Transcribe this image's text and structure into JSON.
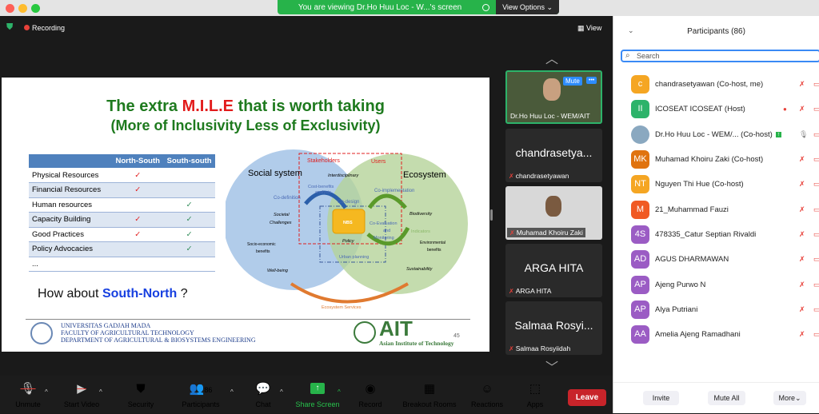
{
  "window": {
    "banner": "You are viewing Dr.Ho Huu Loc - W...'s screen",
    "view_options": "View Options",
    "recording": "Recording",
    "view": "View"
  },
  "slide": {
    "title_pre": "The extra ",
    "title_mile": "M.I.L.E",
    "title_post": " that is worth taking",
    "subtitle": "(More of Inclusivity Less of Exclusivity)",
    "table": {
      "headers": [
        "",
        "North-South",
        "South-south"
      ],
      "rows": [
        [
          "Physical Resources",
          true,
          false
        ],
        [
          "Financial Resources",
          true,
          false
        ],
        [
          "Human resources",
          false,
          true
        ],
        [
          "Capacity Building",
          true,
          true
        ],
        [
          "Good Practices",
          true,
          true
        ],
        [
          "Policy Advocacies",
          false,
          true
        ],
        [
          "...",
          false,
          false
        ]
      ]
    },
    "check": "✓",
    "question_pre": "How about ",
    "question_em": "South-North",
    "question_post": " ?",
    "diagram": {
      "social": "Social system",
      "eco": "Ecosystem",
      "stakeholders": "Stakeholders",
      "users": "Users",
      "interdisciplinary": "Interdisciplinary",
      "cost1": "Cost-benefits",
      "cost2": "analysis",
      "codef": "Co-definition",
      "codesign": "Co-design",
      "coimpl": "Co-implementation",
      "nbs": "NBS",
      "policy": "Policy",
      "coev1": "Co-Evaluation",
      "coev2": "and",
      "coev3": "Monitoring",
      "indicators": "Indicators",
      "soc1": "Societal",
      "soc2": "Challenges",
      "bio": "Biodiversity",
      "se1": "Socio-economic",
      "se2": "benefits",
      "env1": "Environmental",
      "env2": "benefits",
      "urban": "Urban planning",
      "wb": "Well-being",
      "sus": "Sustainability",
      "es": "Ecosystem Services"
    },
    "footer": {
      "ugm": [
        "UNIVERSITAS GADJAH MADA",
        "FACULTY OF AGRICULTURAL TECHNOLOGY",
        "DEPARTMENT OF AGRICULTURAL & BIOSYSTEMS ENGINEERING"
      ],
      "ait": "AIT",
      "ait_sub": "Asian Institute of Technology",
      "page": "45"
    }
  },
  "thumbnails": [
    {
      "name": "Dr.Ho Huu Loc - WEM/AIT",
      "mute": "Mute",
      "more": "•••",
      "video": true
    },
    {
      "name": "chandrasetyawan",
      "big": "chandrasetya..."
    },
    {
      "name": "Muhamad Khoiru Zaki",
      "video": true
    },
    {
      "name": "ARGA HITA",
      "big": "ARGA HITA"
    },
    {
      "name": "Salmaa Rosyiidah",
      "big": "Salmaa Rosyi..."
    }
  ],
  "toolbar": {
    "items": [
      "Unmute",
      "Start Video",
      "Security",
      "Participants",
      "Chat",
      "Share Screen",
      "Record",
      "Breakout Rooms",
      "Reactions",
      "Apps"
    ],
    "participant_count": "86",
    "leave": "Leave"
  },
  "participants": {
    "title": "Participants (86)",
    "search_placeholder": "Search",
    "list": [
      {
        "initials": "c",
        "name": "chandrasetyawan (Co-host, me)",
        "color": "#f5a623"
      },
      {
        "initials": "II",
        "name": "ICOSEAT ICOSEAT (Host)",
        "color": "#2db36a"
      },
      {
        "initials": "",
        "name": "Dr.Ho Huu Loc - WEM/...  (Co-host)",
        "color": "#8aa8c0"
      },
      {
        "initials": "MK",
        "name": "Muhamad Khoiru Zaki (Co-host)",
        "color": "#e0730f"
      },
      {
        "initials": "NT",
        "name": "Nguyen Thi Hue (Co-host)",
        "color": "#f5a623"
      },
      {
        "initials": "M",
        "name": "21_Muhammad Fauzi",
        "color": "#f05a24"
      },
      {
        "initials": "4S",
        "name": "478335_Catur Septian Rivaldi",
        "color": "#9b5cc4"
      },
      {
        "initials": "AD",
        "name": "AGUS DHARMAWAN",
        "color": "#9b5cc4"
      },
      {
        "initials": "AP",
        "name": "Ajeng Purwo N",
        "color": "#9b5cc4"
      },
      {
        "initials": "AP",
        "name": "Alya Putriani",
        "color": "#9b5cc4"
      },
      {
        "initials": "AA",
        "name": "Amelia Ajeng Ramadhani",
        "color": "#9b5cc4"
      }
    ],
    "invite": "Invite",
    "mute_all": "Mute All",
    "more": "More"
  }
}
